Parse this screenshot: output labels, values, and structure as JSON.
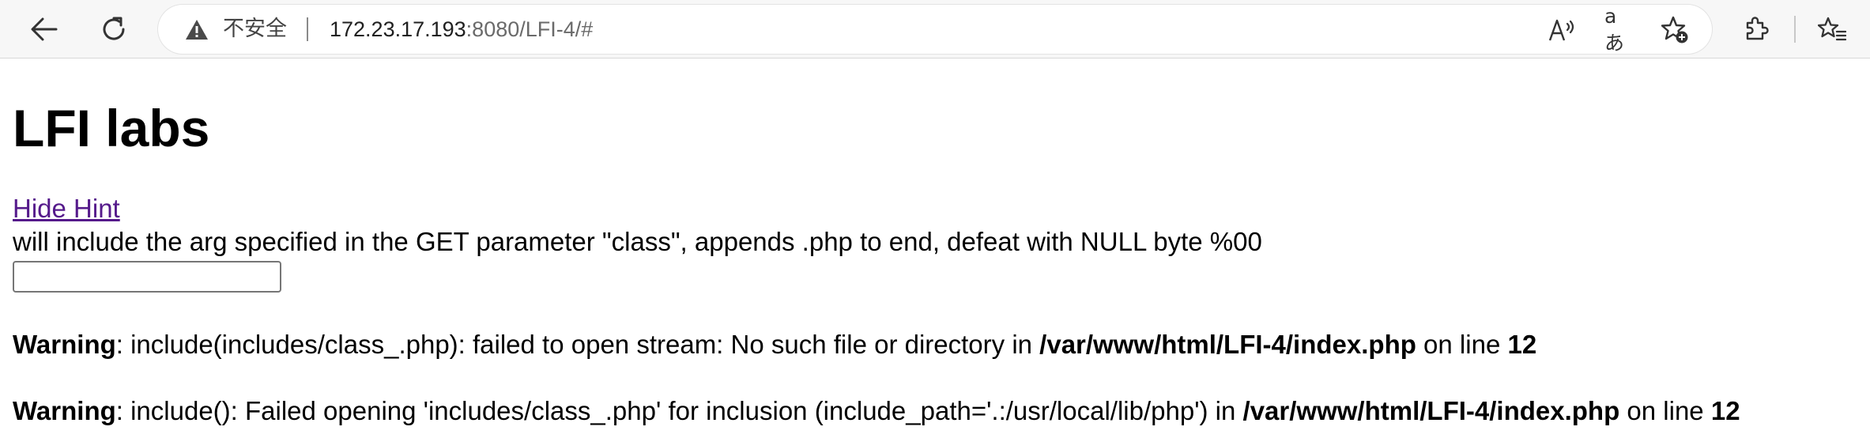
{
  "browser": {
    "security_label": "不安全",
    "url_host": "172.23.17.193",
    "url_rest": ":8080/LFI-4/#",
    "read_aloud_glyph": "A)",
    "translate_glyph": "aあ"
  },
  "page": {
    "title": "LFI labs",
    "hint_link": "Hide Hint",
    "hint_text": "will include the arg specified in the GET parameter \"class\", appends .php to end, defeat with NULL byte %00",
    "input_value": "",
    "warnings": [
      {
        "label": "Warning",
        "message": ": include(includes/class_.php): failed to open stream: No such file or directory in ",
        "file": "/var/www/html/LFI-4/index.php",
        "on_line": " on line ",
        "line": "12"
      },
      {
        "label": "Warning",
        "message": ": include(): Failed opening 'includes/class_.php' for inclusion (include_path='.:/usr/local/lib/php') in ",
        "file": "/var/www/html/LFI-4/index.php",
        "on_line": " on line ",
        "line": "12"
      }
    ]
  },
  "colors": {
    "link_visited": "#551a8b",
    "toolbar_bg": "#f7f7f7"
  }
}
